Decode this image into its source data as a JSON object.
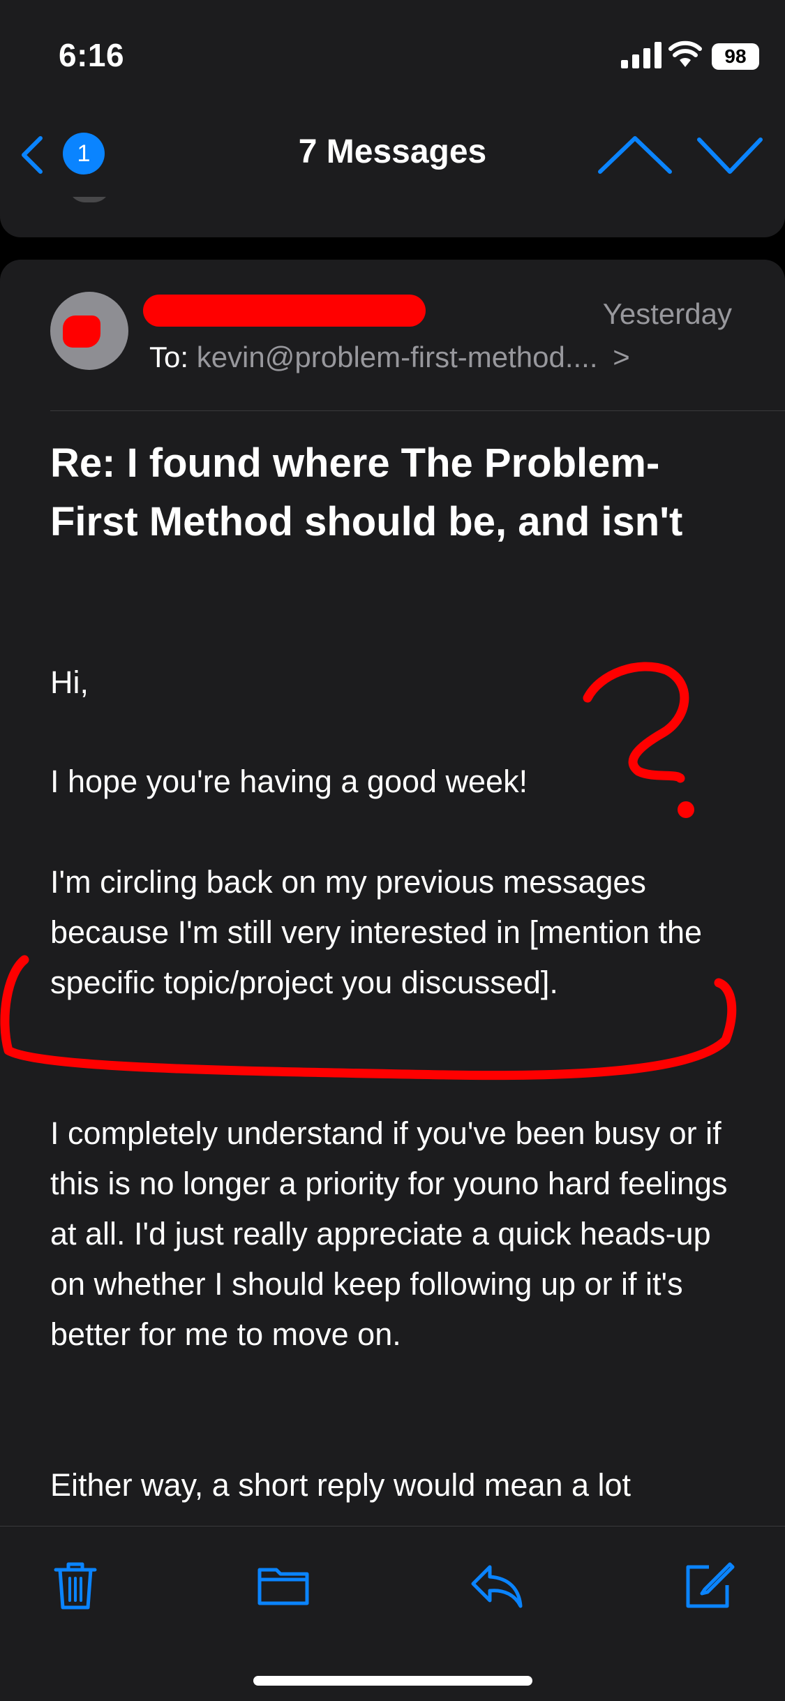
{
  "status_bar": {
    "time": "6:16",
    "battery": "98",
    "icons": [
      "signal-icon",
      "wifi-icon",
      "battery-icon"
    ]
  },
  "nav": {
    "back_badge": "1",
    "title": "7 Messages",
    "icons": [
      "chevron-left-icon",
      "chevron-up-icon",
      "chevron-down-icon"
    ]
  },
  "message": {
    "date": "Yesterday",
    "to_label": "To:",
    "to_address": "kevin@problem-first-method....",
    "to_chevron": ">",
    "subject": "Re: I found where The Problem-First Method should be, and isn't",
    "body": {
      "greeting": "Hi,",
      "week": "I hope you're having a good week!",
      "circling": "I'm circling back on my previous messages because I'm still very interested in [mention the specific topic/project you discussed].",
      "understand": "I completely understand if you've been busy or if this is no longer a priority for youno hard feelings at all. I'd just really appreciate a quick heads-up on whether I should keep following up or if it's better for me to move on.",
      "either": "Either way, a short reply would mean a lot"
    }
  },
  "toolbar": {
    "icons": [
      "trash-icon",
      "folder-icon",
      "reply-icon",
      "compose-icon"
    ]
  },
  "colors": {
    "accent": "#0a84ff",
    "background": "#000000",
    "card": "#1c1c1e",
    "secondary_text": "#98989d",
    "annotation": "#ff0000"
  }
}
